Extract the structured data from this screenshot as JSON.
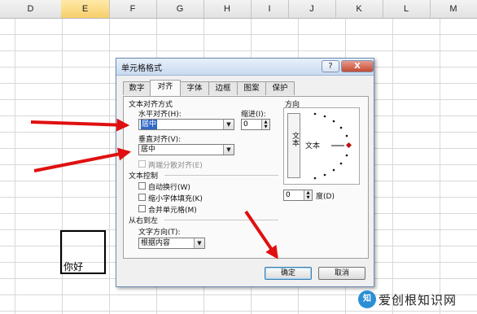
{
  "columns": [
    "D",
    "E",
    "F",
    "G",
    "H",
    "I",
    "J",
    "K",
    "L",
    "M"
  ],
  "selected_column": "E",
  "cell": {
    "text": "你好"
  },
  "dialog": {
    "title": "单元格格式",
    "help_btn": "?",
    "close_btn": "X",
    "tabs": [
      "数字",
      "对齐",
      "字体",
      "边框",
      "图案",
      "保护"
    ],
    "active_tab": "对齐",
    "text_alignment": {
      "section_label": "文本对齐方式",
      "horizontal_label": "水平对齐(H):",
      "horizontal_value": "居中",
      "indent_label": "缩进(I):",
      "indent_value": "0",
      "vertical_label": "垂直对齐(V):",
      "vertical_value": "居中",
      "distributed_label": "两端分散对齐(E)"
    },
    "text_control": {
      "section_label": "文本控制",
      "wrap": "自动换行(W)",
      "shrink": "缩小字体填充(K)",
      "merge": "合并单元格(M)"
    },
    "rtl": {
      "section_label": "从右到左",
      "direction_label": "文字方向(T):",
      "direction_value": "根据内容"
    },
    "orientation": {
      "section_label": "方向",
      "vertical_text": "文本",
      "horizontal_text": "文本",
      "degrees_value": "0",
      "degrees_label": "度(D)"
    },
    "ok_label": "确定",
    "cancel_label": "取消"
  },
  "watermark": {
    "logo": "知",
    "text": "爱创根知识网"
  },
  "colors": {
    "arrow": "#e01010",
    "selection_fill": "#3169c6"
  }
}
